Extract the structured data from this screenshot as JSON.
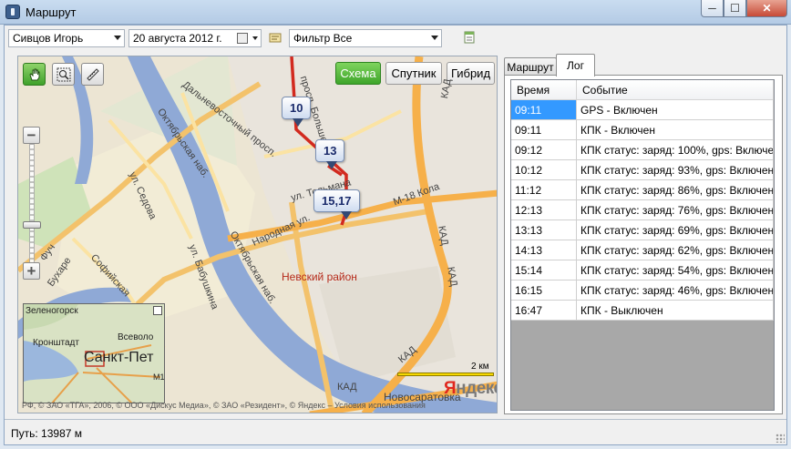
{
  "window": {
    "title": "Маршрут",
    "min_label": "─",
    "max_label": "☐",
    "close_label": "✕"
  },
  "toolbar": {
    "driver": "Сивцов Игорь",
    "date": "20  августа  2012 г.",
    "filter": "Фильтр Все"
  },
  "map": {
    "types": {
      "scheme": "Схема",
      "satellite": "Спутник",
      "hybrid": "Гибрид",
      "active": "Схема"
    },
    "zoom_in": "+",
    "zoom_out": "−",
    "markers": [
      "10",
      "13",
      "15,17"
    ],
    "labels": {
      "nevsky": "Невский район",
      "oktyabrskaya_nab": "Октябрьская наб.",
      "oktyabrskaya_nab2": "Октябрьская наб.",
      "dalnevost": "Дальневосточный просп.",
      "bolshevikov": "просп. Большевиков",
      "sedova": "ул. Седова",
      "babushkina": "ул. Бабушкина",
      "narodnaya": "Народная ул.",
      "telmana": "ул. Тельмана",
      "m18": "M-18 Кола",
      "kad1": "КАД",
      "kad2": "КАД",
      "kad3": "КАД",
      "kad4": "КАД",
      "kad5": "КАД",
      "novosaratovka": "Новосаратовка",
      "sofiyskaya": "Софийская",
      "bukharestskaya": "Бухаре",
      "fucha": "Фуч"
    },
    "minimap": {
      "zelenogorsk": "Зеленогорск",
      "kronshtadt": "Кронштадт",
      "vsevolozhsk": "Всеволо",
      "spb": "Санкт-Пет",
      "m10": "M10"
    },
    "scale": "2 км",
    "yandex_y": "Я",
    "yandex_rest": "ндекс",
    "copyright": "РФ, © ЗАО «ТГА», 2006, © ООО «Дискус Медиа», © ЗАО «Резидент», © Яндекс – Условия использования"
  },
  "tabs": [
    "Маршрут",
    "Лог"
  ],
  "log": {
    "columns": [
      "Время",
      "Событие"
    ],
    "rows": [
      {
        "time": "09:11",
        "event": "GPS - Включен"
      },
      {
        "time": "09:11",
        "event": "КПК - Включен"
      },
      {
        "time": "09:12",
        "event": "КПК статус: заряд: 100%, gps: Включен"
      },
      {
        "time": "10:12",
        "event": "КПК статус: заряд: 93%, gps: Включен"
      },
      {
        "time": "11:12",
        "event": "КПК статус: заряд: 86%, gps: Включен"
      },
      {
        "time": "12:13",
        "event": "КПК статус: заряд: 76%, gps: Включен"
      },
      {
        "time": "13:13",
        "event": "КПК статус: заряд: 69%, gps: Включен"
      },
      {
        "time": "14:13",
        "event": "КПК статус: заряд: 62%, gps: Включен"
      },
      {
        "time": "15:14",
        "event": "КПК статус: заряд: 54%, gps: Включен"
      },
      {
        "time": "16:15",
        "event": "КПК статус: заряд: 46%, gps: Включен"
      },
      {
        "time": "16:47",
        "event": "КПК - Выключен"
      }
    ]
  },
  "status": {
    "path": "Путь: 13987 м"
  },
  "colors": {
    "route": "#d22a1f",
    "river": "#8fa9d6",
    "road_major": "#f3c26b",
    "accent_green": "#3ea52a",
    "selection": "#3399ff"
  }
}
